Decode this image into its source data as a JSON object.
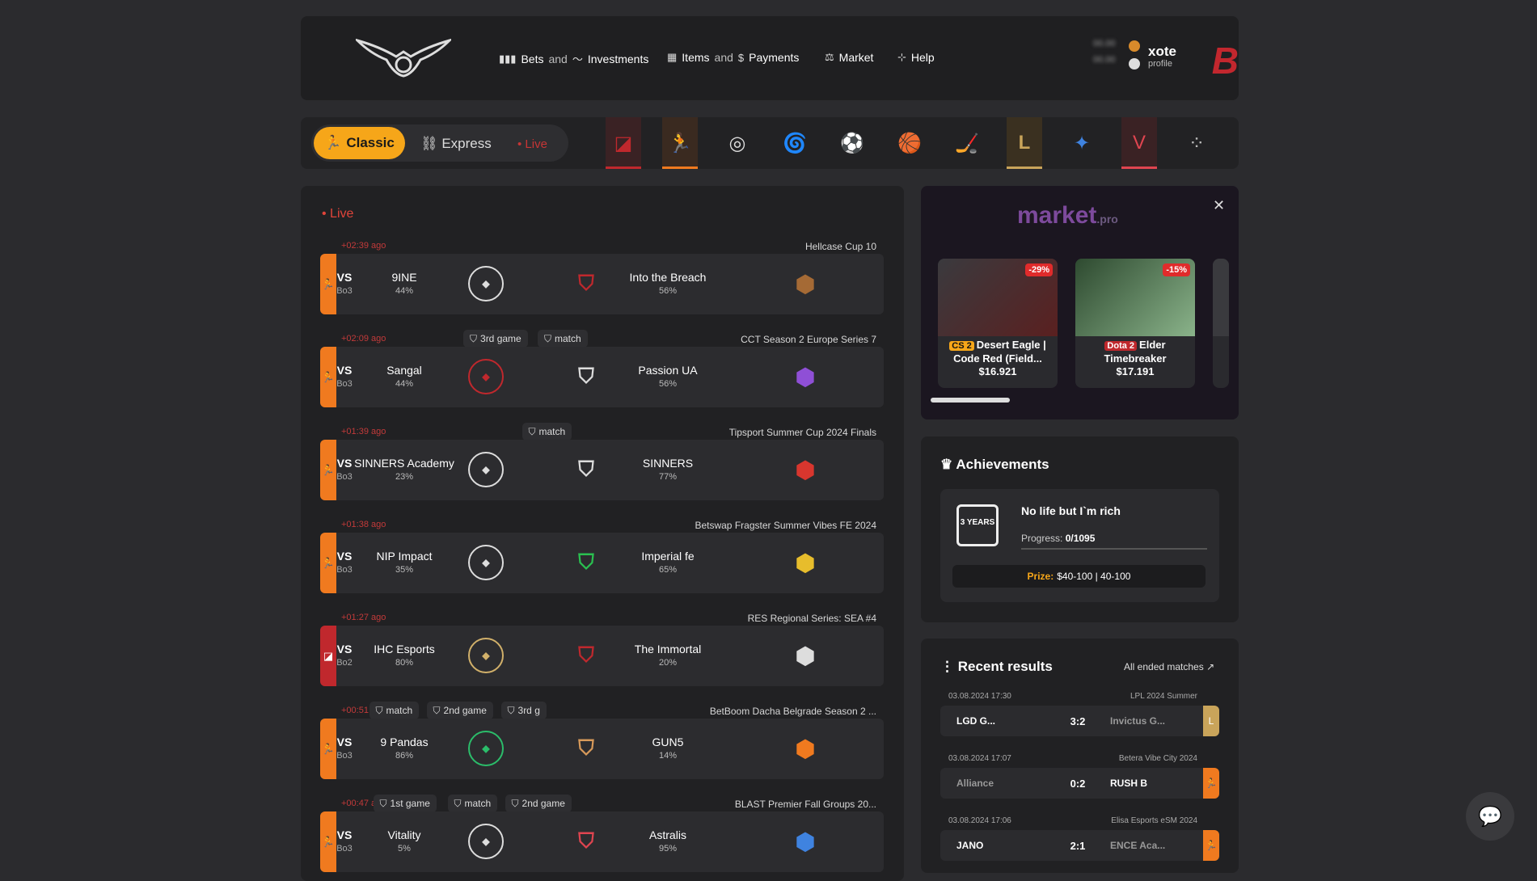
{
  "nav": {
    "bets": "Bets",
    "and1": "and",
    "investments": "Investments",
    "items": "Items",
    "and2": "and",
    "payments": "Payments",
    "market": "Market",
    "help": "Help"
  },
  "user": {
    "name": "xote",
    "profile": "profile",
    "balance1": "00.00",
    "balance2": "00.00"
  },
  "modes": {
    "classic": "Classic",
    "express": "Express",
    "live": "• Live"
  },
  "live": {
    "header": "• Live",
    "matches": [
      {
        "ago": "+02:39 ago",
        "tournament": "Hellcase Cup 10",
        "chips": [],
        "team1": "9INE",
        "p1": "44%",
        "team2": "Into the Breach",
        "p2": "56%",
        "vs": "VS",
        "bo": "Bo3"
      },
      {
        "ago": "+02:09 ago",
        "tournament": "CCT Season 2 Europe Series 7",
        "chips": [
          "3rd game",
          "match"
        ],
        "team1": "Sangal",
        "p1": "44%",
        "team2": "Passion UA",
        "p2": "56%",
        "vs": "VS",
        "bo": "Bo3"
      },
      {
        "ago": "+01:39 ago",
        "tournament": "Tipsport Summer Cup 2024 Finals",
        "chips": [
          "match"
        ],
        "team1": "SINNERS Academy",
        "p1": "23%",
        "team2": "SINNERS",
        "p2": "77%",
        "vs": "VS",
        "bo": "Bo3"
      },
      {
        "ago": "+01:38 ago",
        "tournament": "Betswap Fragster Summer Vibes FE 2024",
        "chips": [],
        "team1": "NIP Impact",
        "p1": "35%",
        "team2": "Imperial fe",
        "p2": "65%",
        "vs": "VS",
        "bo": "Bo3"
      },
      {
        "ago": "+01:27 ago",
        "tournament": "RES Regional Series: SEA #4",
        "chips": [],
        "team1": "IHC Esports",
        "p1": "80%",
        "team2": "The Immortal",
        "p2": "20%",
        "vs": "VS",
        "bo": "Bo2"
      },
      {
        "ago": "+00:51 ago",
        "tournament": "BetBoom Dacha Belgrade Season 2 ...",
        "chips": [
          "match",
          "2nd game",
          "3rd g"
        ],
        "team1": "9 Pandas",
        "p1": "86%",
        "team2": "GUN5",
        "p2": "14%",
        "vs": "VS",
        "bo": "Bo3"
      },
      {
        "ago": "+00:47 ago",
        "tournament": "BLAST Premier Fall Groups 20...",
        "chips": [
          "1st game",
          "match",
          "2nd game"
        ],
        "team1": "Vitality",
        "p1": "5%",
        "team2": "Astralis",
        "p2": "95%",
        "vs": "VS",
        "bo": "Bo3"
      }
    ]
  },
  "market": {
    "logo": "market",
    "logo_suffix": ".pro",
    "items": [
      {
        "tag": "CS 2",
        "name": "Desert Eagle | Code Red (Field...",
        "price": "$16.921",
        "discount": "-29%"
      },
      {
        "tag": "Dota 2",
        "name": "Elder Timebreaker",
        "price": "$17.191",
        "discount": "-15%"
      }
    ]
  },
  "achievements": {
    "title": "Achievements",
    "card_title": "No life but I`m rich",
    "progress_label": "Progress:",
    "progress_value": "0/1095",
    "prize_label": "Prize:",
    "prize_value": "$40-100 | 40-100",
    "badge": "3 YEARS"
  },
  "recent": {
    "title": "Recent results",
    "all_link": "All ended matches",
    "rows": [
      {
        "date": "03.08.2024 17:30",
        "tournament": "LPL 2024 Summer",
        "team1": "LGD G...",
        "score": "3:2",
        "team2": "Invictus G..."
      },
      {
        "date": "03.08.2024 17:07",
        "tournament": "Betera Vibe City 2024",
        "team1": "Alliance",
        "score": "0:2",
        "team2": "RUSH B"
      },
      {
        "date": "03.08.2024 17:06",
        "tournament": "Elisa Esports eSM 2024",
        "team1": "JANO",
        "score": "2:1",
        "team2": "ENCE Aca..."
      }
    ]
  },
  "colors": {
    "accent": "#f6a619",
    "live": "#e0443a",
    "cs_stripe": "#f07a1f",
    "dota_stripe": "#c0282d"
  }
}
